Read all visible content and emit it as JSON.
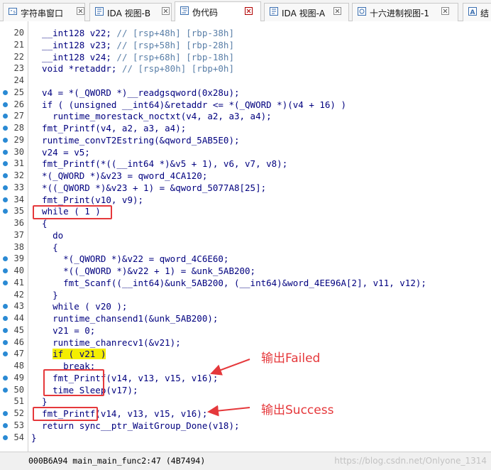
{
  "tabs": [
    {
      "label": "字符串窗口",
      "icon": "strings-window-icon",
      "active": false
    },
    {
      "label": "IDA 视图-B",
      "icon": "ida-view-icon",
      "active": false
    },
    {
      "label": "伪代码",
      "icon": "pseudocode-icon",
      "active": true
    },
    {
      "label": "IDA 视图-A",
      "icon": "ida-view-icon",
      "active": false
    },
    {
      "label": "十六进制视图-1",
      "icon": "hex-view-icon",
      "active": false
    },
    {
      "label": "结",
      "icon": "structures-icon",
      "active": false
    }
  ],
  "colors": {
    "keyword": "#00007f",
    "comment": "#5a7fa8",
    "highlight": "#f4ee00",
    "annotation": "#e5383b",
    "breakpoint": "#2a8ad4"
  },
  "code": [
    {
      "num": "20",
      "bp": false,
      "parts": [
        {
          "t": "  __int128 v22; "
        },
        {
          "t": "// [rsp+48h] [rbp-38h]",
          "c": 1
        }
      ]
    },
    {
      "num": "21",
      "bp": false,
      "parts": [
        {
          "t": "  __int128 v23; "
        },
        {
          "t": "// [rsp+58h] [rbp-28h]",
          "c": 1
        }
      ]
    },
    {
      "num": "22",
      "bp": false,
      "parts": [
        {
          "t": "  __int128 v24; "
        },
        {
          "t": "// [rsp+68h] [rbp-18h]",
          "c": 1
        }
      ]
    },
    {
      "num": "23",
      "bp": false,
      "parts": [
        {
          "t": "  void *retaddr; "
        },
        {
          "t": "// [rsp+80h] [rbp+0h]",
          "c": 1
        }
      ]
    },
    {
      "num": "24",
      "bp": false,
      "parts": [
        {
          "t": ""
        }
      ]
    },
    {
      "num": "25",
      "bp": true,
      "parts": [
        {
          "t": "  v4 = *(_QWORD *)__readgsqword(0x28u);"
        }
      ]
    },
    {
      "num": "26",
      "bp": true,
      "parts": [
        {
          "t": "  if ( (unsigned __int64)&retaddr <= *(_QWORD *)(v4 + 16) )"
        }
      ]
    },
    {
      "num": "27",
      "bp": true,
      "parts": [
        {
          "t": "    runtime_morestack_noctxt(v4, a2, a3, a4);"
        }
      ]
    },
    {
      "num": "28",
      "bp": true,
      "parts": [
        {
          "t": "  fmt_Printf(v4, a2, a3, a4);"
        }
      ]
    },
    {
      "num": "29",
      "bp": true,
      "parts": [
        {
          "t": "  runtime_convT2Estring(&qword_5AB5E0);"
        }
      ]
    },
    {
      "num": "30",
      "bp": true,
      "parts": [
        {
          "t": "  v24 = v5;"
        }
      ]
    },
    {
      "num": "31",
      "bp": true,
      "parts": [
        {
          "t": "  fmt_Printf(*((__int64 *)&v5 + 1), v6, v7, v8);"
        }
      ]
    },
    {
      "num": "32",
      "bp": true,
      "parts": [
        {
          "t": "  *(_QWORD *)&v23 = qword_4CA120;"
        }
      ]
    },
    {
      "num": "33",
      "bp": true,
      "parts": [
        {
          "t": "  *((_QWORD *)&v23 + 1) = &qword_5077A8[25];"
        }
      ]
    },
    {
      "num": "34",
      "bp": true,
      "parts": [
        {
          "t": "  fmt_Print(v10, v9);"
        }
      ]
    },
    {
      "num": "35",
      "bp": true,
      "parts": [
        {
          "t": "  while ( 1 )"
        }
      ]
    },
    {
      "num": "36",
      "bp": false,
      "parts": [
        {
          "t": "  {"
        }
      ]
    },
    {
      "num": "37",
      "bp": false,
      "parts": [
        {
          "t": "    do"
        }
      ]
    },
    {
      "num": "38",
      "bp": false,
      "parts": [
        {
          "t": "    {"
        }
      ]
    },
    {
      "num": "39",
      "bp": true,
      "parts": [
        {
          "t": "      *(_QWORD *)&v22 = qword_4C6E60;"
        }
      ]
    },
    {
      "num": "40",
      "bp": true,
      "parts": [
        {
          "t": "      *((_QWORD *)&v22 + 1) = &unk_5AB200;"
        }
      ]
    },
    {
      "num": "41",
      "bp": true,
      "parts": [
        {
          "t": "      fmt_Scanf((__int64)&unk_5AB200, (__int64)&word_4EE96A[2], v11, v12);"
        }
      ]
    },
    {
      "num": "42",
      "bp": false,
      "parts": [
        {
          "t": "    }"
        }
      ]
    },
    {
      "num": "43",
      "bp": true,
      "parts": [
        {
          "t": "    while ( v20 );"
        }
      ]
    },
    {
      "num": "44",
      "bp": true,
      "parts": [
        {
          "t": "    runtime_chansend1(&unk_5AB200);"
        }
      ]
    },
    {
      "num": "45",
      "bp": true,
      "parts": [
        {
          "t": "    v21 = 0;"
        }
      ]
    },
    {
      "num": "46",
      "bp": true,
      "parts": [
        {
          "t": "    runtime_chanrecv1(&v21);"
        }
      ]
    },
    {
      "num": "47",
      "bp": true,
      "parts": [
        {
          "t": "    "
        },
        {
          "t": "if ( v21 )",
          "h": 1
        }
      ]
    },
    {
      "num": "48",
      "bp": false,
      "parts": [
        {
          "t": "      break;"
        }
      ]
    },
    {
      "num": "49",
      "bp": true,
      "parts": [
        {
          "t": "    fmt_Printf(v14, v13, v15, v16);"
        }
      ]
    },
    {
      "num": "50",
      "bp": true,
      "parts": [
        {
          "t": "    time_Sleep(v17);"
        }
      ]
    },
    {
      "num": "51",
      "bp": false,
      "parts": [
        {
          "t": "  }"
        }
      ]
    },
    {
      "num": "52",
      "bp": true,
      "parts": [
        {
          "t": "  fmt_Printf(v14, v13, v15, v16);"
        }
      ]
    },
    {
      "num": "53",
      "bp": true,
      "parts": [
        {
          "t": "  return sync__ptr_WaitGroup_Done(v18);"
        }
      ]
    },
    {
      "num": "54",
      "bp": true,
      "parts": [
        {
          "t": "}"
        }
      ]
    }
  ],
  "annotations": {
    "failed": "输出Failed",
    "success": "输出Success"
  },
  "status": {
    "text": "000B6A94 main_main_func2:47 (4B7494)",
    "watermark": "https://blog.csdn.net/Onlyone_1314"
  }
}
